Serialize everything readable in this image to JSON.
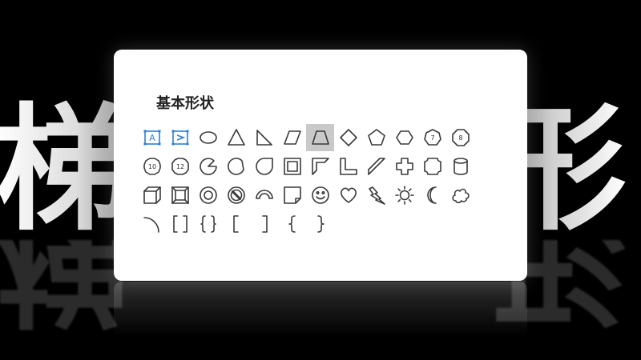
{
  "background": {
    "left_char": "梯",
    "right_char": "形"
  },
  "panel": {
    "title": "基本形状",
    "selected_shape": "trapezoid",
    "rows": [
      [
        "text-box",
        "vertical-text-box",
        "oval",
        "triangle",
        "right-triangle",
        "parallelogram",
        "trapezoid",
        "diamond",
        "pentagon",
        "hexagon",
        "heptagon",
        "octagon"
      ],
      [
        "decagon",
        "dodecagon",
        "pie",
        "chord",
        "teardrop",
        "frame",
        "half-frame",
        "l-shape",
        "diagonal-stripe",
        "cross",
        "plaque",
        "can"
      ],
      [
        "cube",
        "bevel",
        "donut",
        "no-symbol",
        "block-arc",
        "folded-corner",
        "smiley-face",
        "heart",
        "lightning-bolt",
        "sun",
        "moon",
        "cloud"
      ],
      [
        "arc",
        "double-bracket",
        "double-brace",
        "left-bracket",
        "right-bracket",
        "left-brace",
        "right-brace"
      ]
    ],
    "labels": {
      "text_box": "A",
      "heptagon": "7",
      "octagon": "8",
      "decagon": "10",
      "dodecagon": "12"
    }
  },
  "colors": {
    "accent": "#2f7fd1",
    "panel_bg": "#ffffff",
    "page_bg": "#000000",
    "selection": "#c9c9c9"
  }
}
